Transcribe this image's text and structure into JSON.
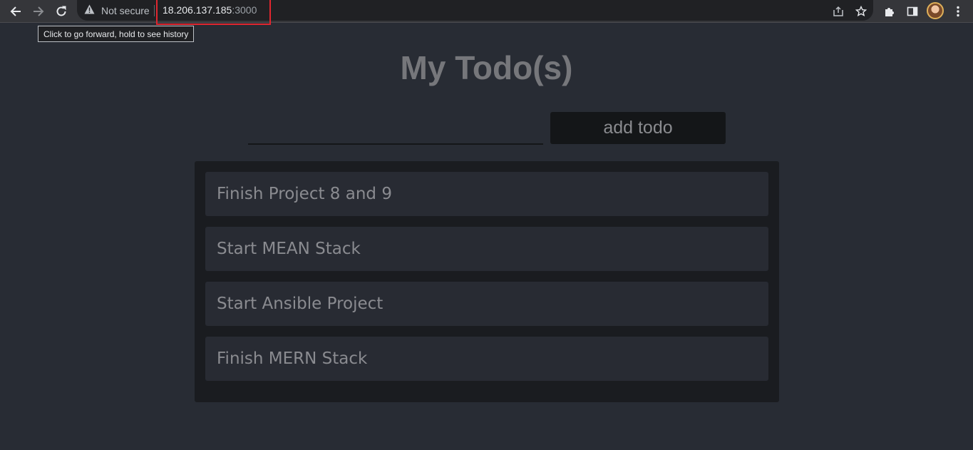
{
  "browser": {
    "security_label": "Not secure",
    "url_host": "18.206.137.185",
    "url_port": ":3000",
    "tooltip": "Click to go forward, hold to see history"
  },
  "page": {
    "title": "My Todo(s)",
    "input": {
      "value": "",
      "placeholder": ""
    },
    "add_button_label": "add todo",
    "todos": [
      "Finish Project 8 and 9",
      "Start MEAN Stack",
      "Start Ansible Project",
      "Finish MERN Stack"
    ]
  },
  "colors": {
    "page_background": "#282c34",
    "list_background": "#1a1c20",
    "item_background": "#282b33",
    "url_highlight": "#e0262f"
  },
  "icons": {
    "back": "arrow-left-icon",
    "forward": "arrow-right-icon",
    "reload": "reload-icon",
    "security": "warning-triangle-icon",
    "share": "share-icon",
    "bookmark": "star-icon",
    "extensions": "puzzle-icon",
    "side_panel": "side-panel-icon",
    "menu": "kebab-menu-icon"
  }
}
